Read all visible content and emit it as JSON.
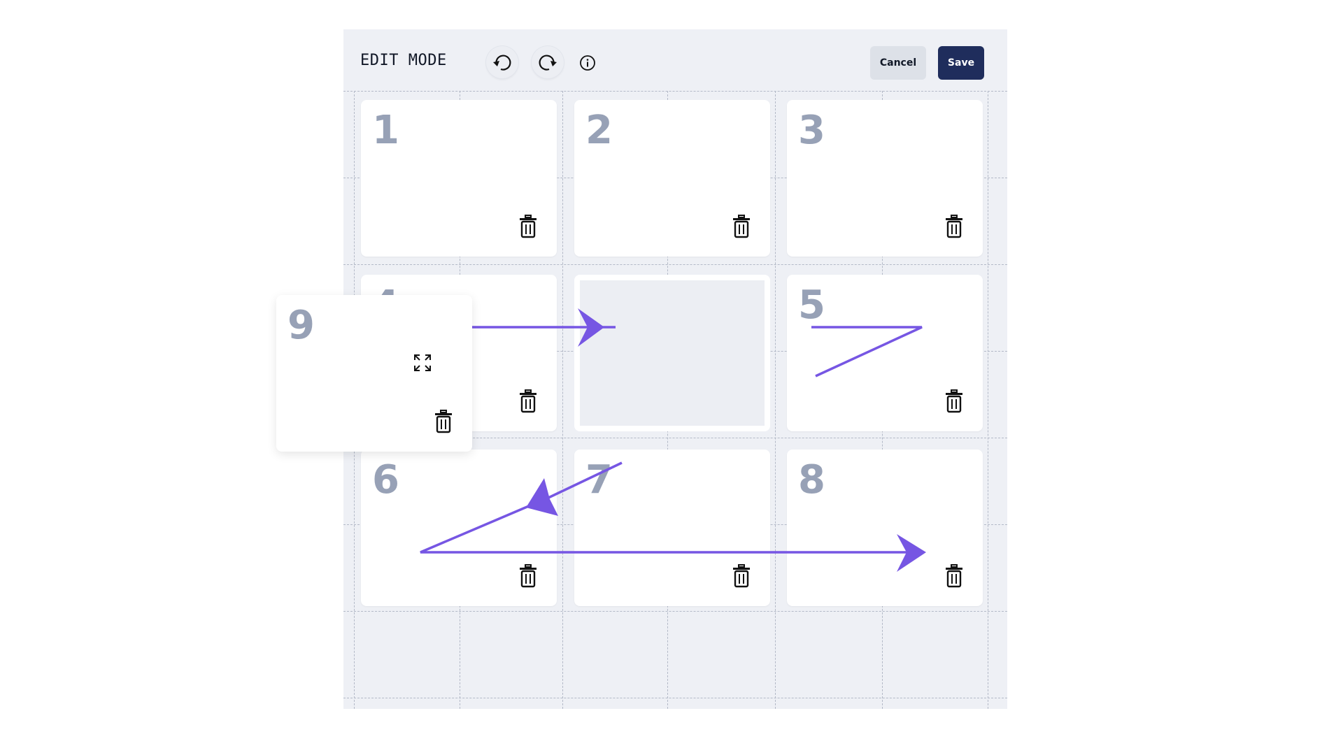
{
  "toolbar": {
    "title": "EDIT MODE",
    "undo_icon": "undo-icon",
    "redo_icon": "redo-icon",
    "info_icon": "info-icon",
    "cancel_label": "Cancel",
    "save_label": "Save"
  },
  "cards": [
    {
      "number": "1"
    },
    {
      "number": "2"
    },
    {
      "number": "3"
    },
    {
      "number": "4"
    },
    {
      "number": "5"
    },
    {
      "number": "6"
    },
    {
      "number": "7"
    },
    {
      "number": "8"
    }
  ],
  "dragged_card": {
    "number": "9"
  },
  "colors": {
    "accent": "#7656e3",
    "save_button": "#1f2d5c",
    "card_number": "#97a1b6",
    "canvas": "#eef0f5"
  }
}
